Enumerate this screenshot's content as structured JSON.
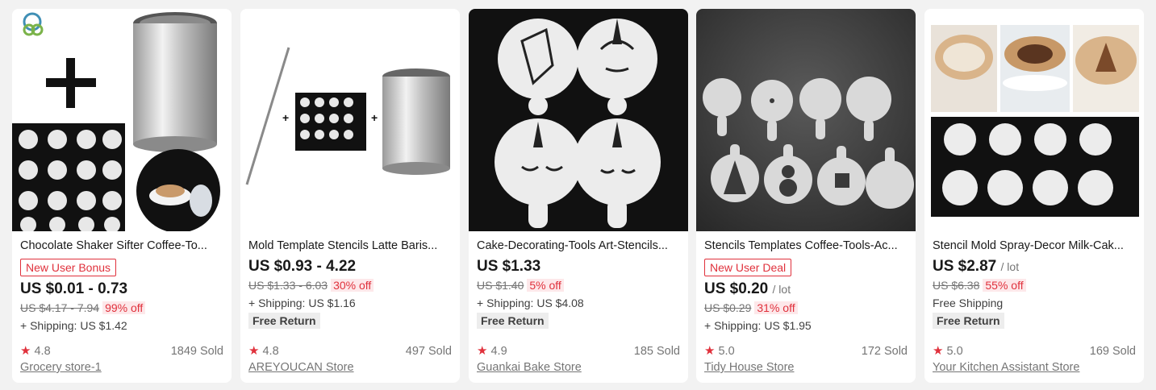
{
  "products": [
    {
      "title": "Chocolate Shaker Sifter Coffee-To...",
      "badge": "New User Bonus",
      "price": "US $0.01 - 0.73",
      "unit": "",
      "original_price": "US $4.17 - 7.94",
      "discount": "99% off",
      "shipping": "+ Shipping: US $1.42",
      "free_return": "",
      "rating": "4.8",
      "sold": "1849 Sold",
      "store": "Grocery store-1",
      "image_icon": "shaker-stencil-set-image"
    },
    {
      "title": "Mold Template Stencils Latte Baris...",
      "badge": "",
      "price": "US $0.93 - 4.22",
      "unit": "",
      "original_price": "US $1.33 - 6.03",
      "discount": "30% off",
      "shipping": "+ Shipping: US $1.16",
      "free_return": "Free Return",
      "rating": "4.8",
      "sold": "497 Sold",
      "store": "AREYOUCAN Store",
      "image_icon": "needle-stencil-shaker-image"
    },
    {
      "title": "Cake-Decorating-Tools Art-Stencils...",
      "badge": "",
      "price": "US $1.33",
      "unit": "",
      "original_price": "US $1.40",
      "discount": "5% off",
      "shipping": "+ Shipping: US $4.08",
      "free_return": "Free Return",
      "rating": "4.9",
      "sold": "185 Sold",
      "store": "Guankai Bake Store",
      "image_icon": "unicorn-stencils-image"
    },
    {
      "title": "Stencils Templates Coffee-Tools-Ac...",
      "badge": "New User Deal",
      "price": "US $0.20",
      "unit": "/ lot",
      "original_price": "US $0.29",
      "discount": "31% off",
      "shipping": "+ Shipping: US $1.95",
      "free_return": "",
      "rating": "5.0",
      "sold": "172 Sold",
      "store": "Tidy House Store",
      "image_icon": "christmas-stencils-image"
    },
    {
      "title": "Stencil Mold Spray-Decor Milk-Cak...",
      "badge": "",
      "price": "US $2.87",
      "unit": "/ lot",
      "original_price": "US $6.38",
      "discount": "55% off",
      "shipping": "Free Shipping",
      "free_return": "Free Return",
      "rating": "5.0",
      "sold": "169 Sold",
      "store": "Your Kitchen Assistant Store",
      "image_icon": "latte-art-stencils-image"
    }
  ],
  "star_icon": "star-icon",
  "colors": {
    "accent": "#e0313c",
    "muted": "#757575"
  }
}
